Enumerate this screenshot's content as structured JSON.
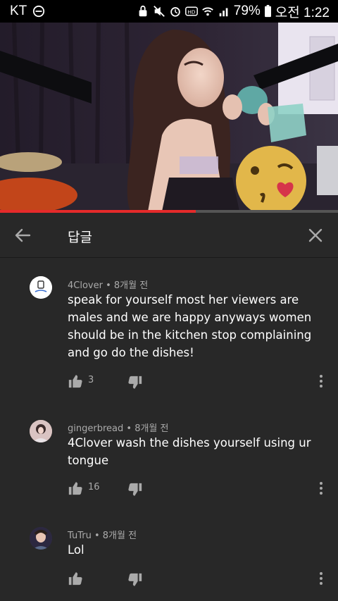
{
  "status_bar": {
    "carrier": "KT",
    "battery": "79%",
    "time": "오전 1:22"
  },
  "video": {
    "progress_fraction": 0.58
  },
  "header": {
    "title": "답글"
  },
  "comments": [
    {
      "author": "4Clover",
      "time": "8개월 전",
      "text": "speak for yourself most her viewers are males and we are happy anyways women should be in the kitchen stop complaining and go do the dishes!",
      "likes": "3",
      "avatar_color": "#ffffff"
    },
    {
      "author": "gingerbread",
      "time": "8개월 전",
      "text": "4Clover wash the dishes yourself using ur tongue",
      "likes": "16",
      "avatar_color": "#c9a9a6"
    },
    {
      "author": "TuTru",
      "time": "8개월 전",
      "text": "Lol",
      "likes": "",
      "avatar_color": "#3a3550"
    }
  ],
  "colors": {
    "background": "#282828",
    "meta_text": "#aaaaaa",
    "progress": "#e52a2a"
  },
  "icons": [
    "back-arrow-icon",
    "close-icon",
    "thumbs-up-icon",
    "thumbs-down-icon",
    "more-vert-icon"
  ]
}
